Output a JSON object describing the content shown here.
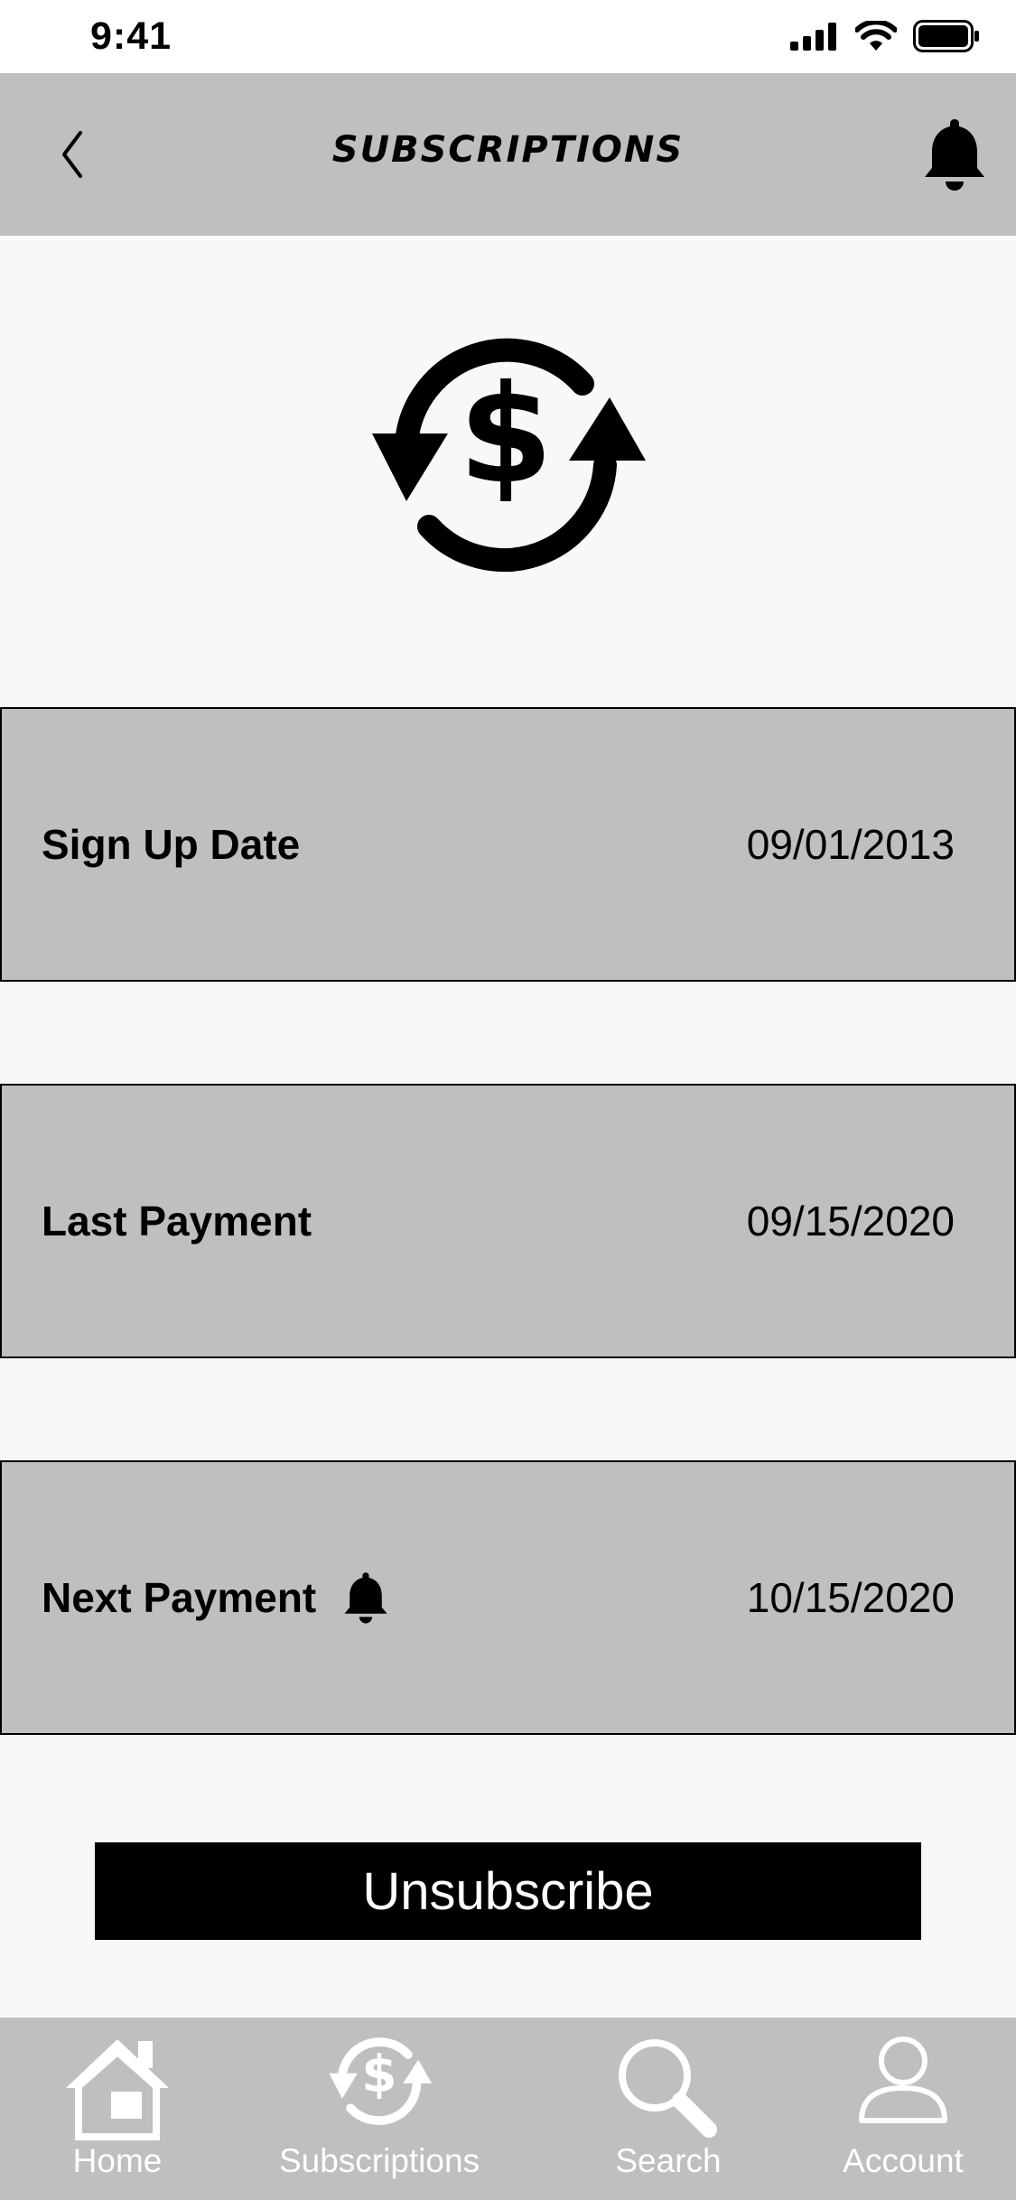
{
  "status_bar": {
    "time": "9:41"
  },
  "header": {
    "title": "SUBSCRIPTIONS"
  },
  "icons": {
    "back": "chevron-left-icon",
    "notifications": "bell-icon",
    "hero": "recurring-payment-icon"
  },
  "details": [
    {
      "label": "Sign Up Date",
      "value": "09/01/2013",
      "has_bell": false
    },
    {
      "label": "Last Payment",
      "value": "09/15/2020",
      "has_bell": false
    },
    {
      "label": "Next Payment",
      "value": "10/15/2020",
      "has_bell": true
    }
  ],
  "actions": {
    "unsubscribe_label": "Unsubscribe"
  },
  "tabbar": {
    "items": [
      {
        "label": "Home",
        "icon": "home-icon"
      },
      {
        "label": "Subscriptions",
        "icon": "subscriptions-icon"
      },
      {
        "label": "Search",
        "icon": "search-icon"
      },
      {
        "label": "Account",
        "icon": "account-icon"
      }
    ]
  },
  "colors": {
    "header_bg": "#bfbfbf",
    "card_bg": "#bfbfbf",
    "page_bg": "#f8f8f8",
    "button_bg": "#000000",
    "tab_label": "#ffffff"
  }
}
